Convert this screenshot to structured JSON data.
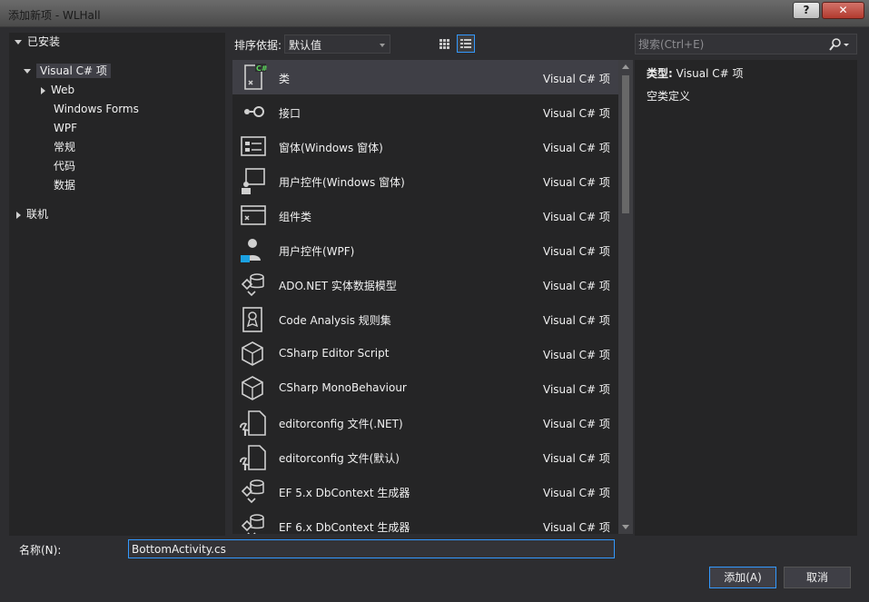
{
  "window": {
    "title": "添加新项 - WLHall",
    "help_label": "?",
    "close_label": "✕"
  },
  "tree": {
    "installed_label": "已安装",
    "selected_node": "Visual C# 项",
    "children": [
      "Web",
      "Windows Forms",
      "WPF",
      "常规",
      "代码",
      "数据"
    ],
    "online_label": "联机"
  },
  "sort": {
    "label": "排序依据:",
    "value": "默认值"
  },
  "search": {
    "placeholder": "搜索(Ctrl+E)"
  },
  "templates": [
    {
      "name": "类",
      "category": "Visual C# 项",
      "icon": "class-icon"
    },
    {
      "name": "接口",
      "category": "Visual C# 项",
      "icon": "interface-icon"
    },
    {
      "name": "窗体(Windows 窗体)",
      "category": "Visual C# 项",
      "icon": "form-icon"
    },
    {
      "name": "用户控件(Windows 窗体)",
      "category": "Visual C# 项",
      "icon": "user-control-icon"
    },
    {
      "name": "组件类",
      "category": "Visual C# 项",
      "icon": "component-class-icon"
    },
    {
      "name": "用户控件(WPF)",
      "category": "Visual C# 项",
      "icon": "wpf-user-control-icon"
    },
    {
      "name": "ADO.NET 实体数据模型",
      "category": "Visual C# 项",
      "icon": "entity-model-icon"
    },
    {
      "name": "Code Analysis 规则集",
      "category": "Visual C# 项",
      "icon": "ruleset-icon"
    },
    {
      "name": "CSharp Editor Script",
      "category": "Visual C# 项",
      "icon": "unity-cube-icon"
    },
    {
      "name": "CSharp MonoBehaviour",
      "category": "Visual C# 项",
      "icon": "unity-cube-icon"
    },
    {
      "name": "editorconfig 文件(.NET)",
      "category": "Visual C# 项",
      "icon": "editorconfig-icon"
    },
    {
      "name": "editorconfig 文件(默认)",
      "category": "Visual C# 项",
      "icon": "editorconfig-icon"
    },
    {
      "name": "EF 5.x DbContext 生成器",
      "category": "Visual C# 项",
      "icon": "dbcontext-generator-icon"
    },
    {
      "name": "EF 6.x DbContext 生成器",
      "category": "Visual C# 项",
      "icon": "dbcontext-generator-icon"
    }
  ],
  "details": {
    "type_label": "类型:",
    "type_value": "Visual C# 项",
    "description": "空类定义"
  },
  "name_field": {
    "label": "名称(N):",
    "value": "BottomActivity.cs"
  },
  "buttons": {
    "add": "添加(A)",
    "cancel": "取消"
  },
  "colors": {
    "accent": "#3399ff",
    "selection": "#3f3f46",
    "panel": "#252526",
    "background": "#2d2d30"
  }
}
